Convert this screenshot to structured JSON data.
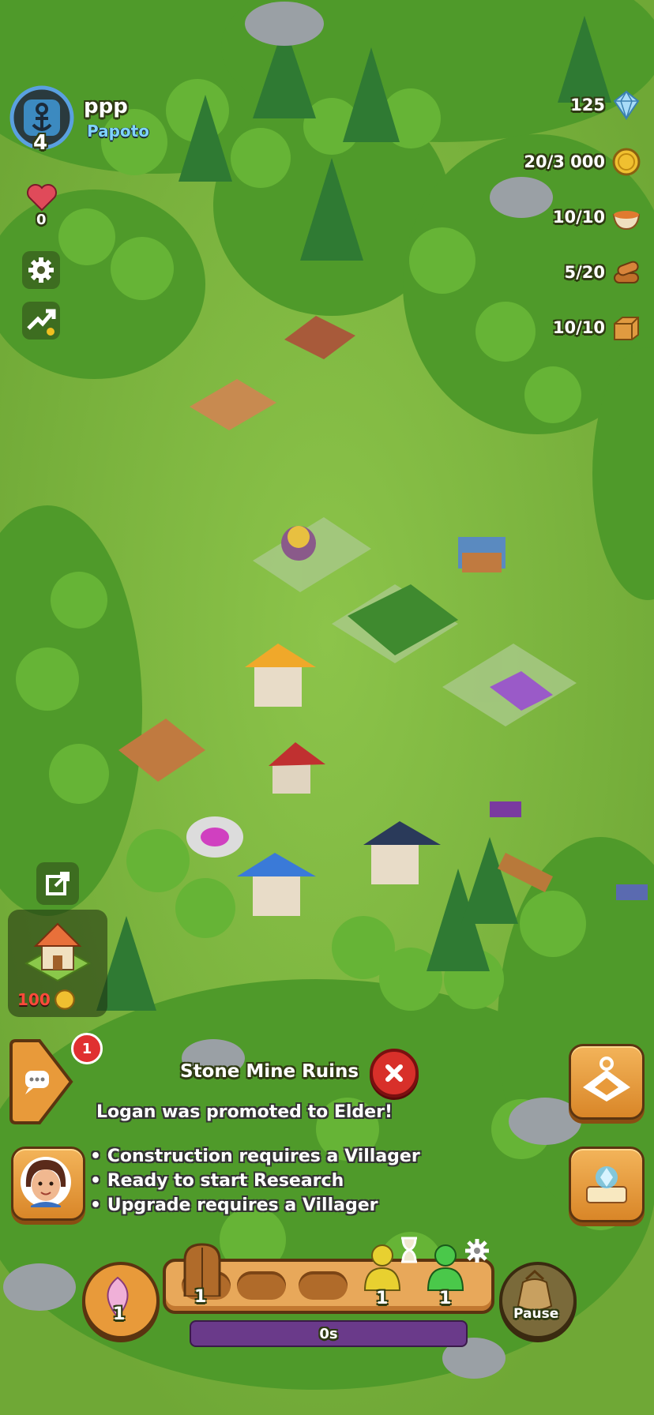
{
  "player": {
    "name": "ppp",
    "clan": "Papoto",
    "level": "4"
  },
  "hearts": {
    "count": "0"
  },
  "resources": {
    "gems": "125",
    "gold": "20/3 000",
    "food": "10/10",
    "wood": "5/20",
    "stone": "10/10"
  },
  "shop": {
    "house_cost": "100"
  },
  "chat": {
    "badge": "1"
  },
  "selection": {
    "title": "Stone Mine Ruins"
  },
  "notifications": {
    "promotion": "Logan was promoted to Elder!",
    "tips": [
      "Construction requires a Villager",
      "Ready to start Research",
      "Upgrade requires a Villager"
    ]
  },
  "bottom_bar": {
    "boost_count": "1",
    "doors_count": "1",
    "villagers_idle": "1",
    "villagers_busy": "1",
    "timer": "0s",
    "pause_label": "Pause"
  },
  "colors": {
    "grass": "#79b43c",
    "accent_orange": "#e89a3a",
    "timer_purple": "#6a3a8a"
  }
}
